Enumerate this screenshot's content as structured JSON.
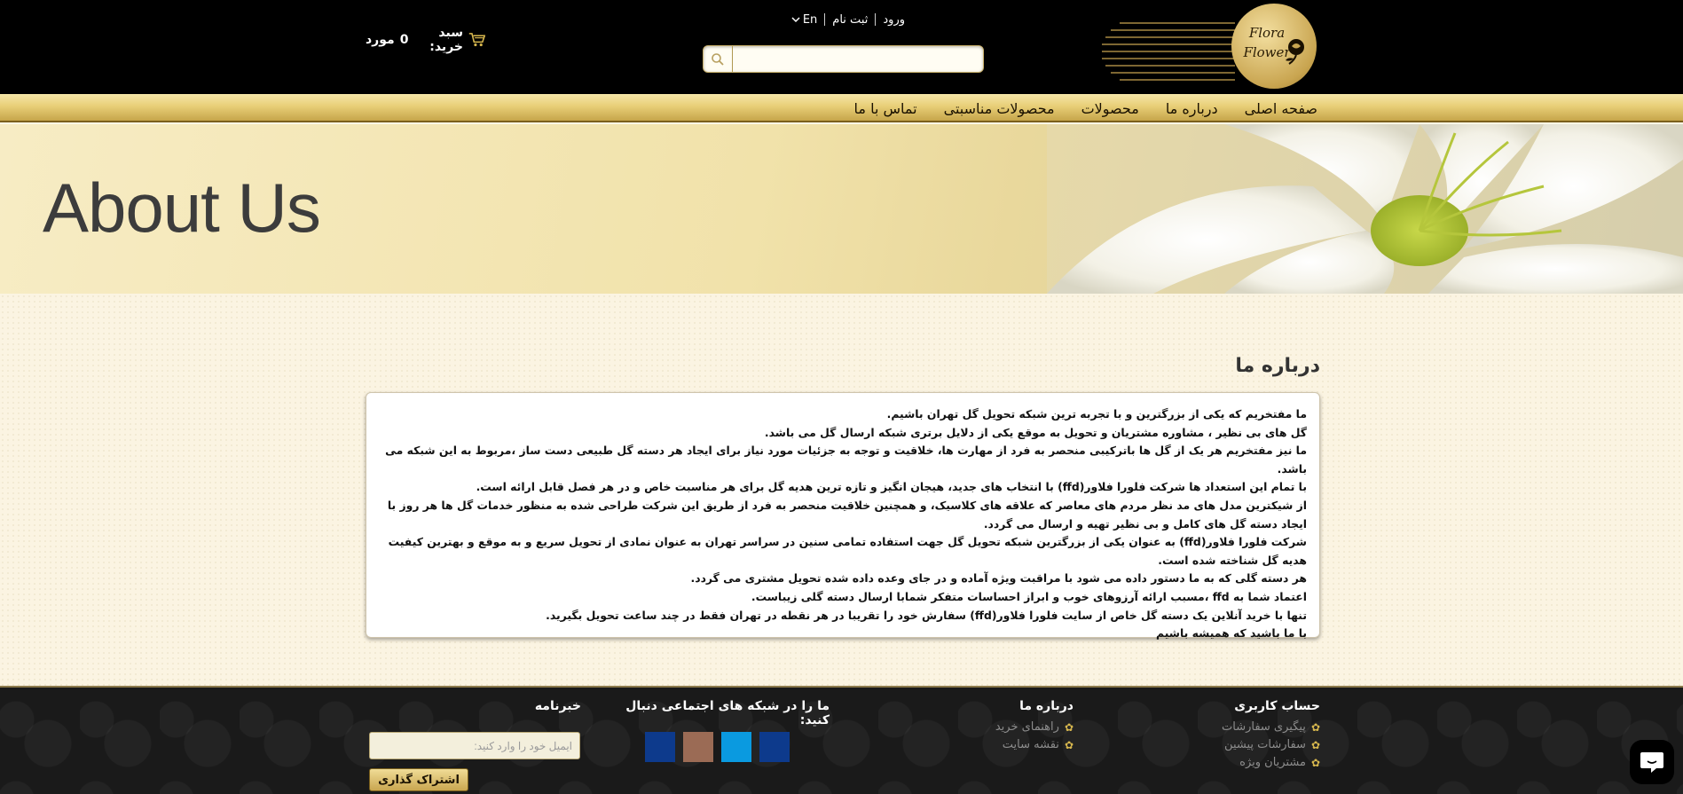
{
  "header": {
    "logo": {
      "line1": "Flora",
      "line2": "Flower"
    },
    "top_links": {
      "login": "ورود",
      "register": "ثبت نام",
      "language": "En"
    },
    "search": {
      "placeholder": ""
    },
    "cart": {
      "label": "سبد خرید:",
      "count": "0",
      "unit": "مورد"
    }
  },
  "nav": {
    "items": [
      {
        "label": "صفحه اصلی"
      },
      {
        "label": "درباره ما"
      },
      {
        "label": "محصولات"
      },
      {
        "label": "محصولات مناسبتی"
      },
      {
        "label": "تماس با ما"
      }
    ]
  },
  "banner": {
    "title": "About Us"
  },
  "main": {
    "title": "درباره ما",
    "paragraphs": [
      "ما مفتخریم که یکی از بزرگترین و با تجربه ترین شبکه تحویل گل تهران باشیم.",
      "گل های بی نظیر ، مشاوره مشتریان و تحویل به موقع یکی از دلایل برتری شبکه ارسال گل می باشد.",
      "ما نیز مفتخریم هر یک از گل ها باترکیبی منحصر به فرد از مهارت ها، خلاقیت و توجه به جزئیات مورد نیاز برای ایجاد هر دسته گل طبیعی دست ساز ،مربوط به این شبکه می باشد.",
      "با تمام این استعداد ها  شرکت فلورا فلاور(ffd) با انتخاب های جدید، هیجان انگیز و تازه ترین هدیه گل برای هر مناسبت خاص و در هر فصل قابل ارائه است.",
      "از شیکترین مدل های مد نظر مردم های معاصر که علاقه های کلاسیک، و همچنین خلاقیت منحصر به فرد از طریق این شرکت طراحی شده به منظور خدمات گل ها هر روز با ایجاد دسته گل های کامل و بی نظیر تهیه و ارسال می گردد.",
      "شرکت فلورا فلاور(ffd) به عنوان یکی از بزرگترین شبکه تحویل گل جهت استفاده تمامی سنین در سراسر تهران به عنوان نمادی از تحویل سریع و به موقع و بهترین کیفیت هدیه گل شناخته شده است.",
      "هر دسته گلی که به ما دستور داده می شود با مراقبت ویژه آماده و در جای وعده داده شده تحویل مشتری می گردد.",
      "اعتماد شما به ffd ،مسبب ارائه آرزوهای خوب و ابراز احساسات متفکر شمابا ارسال دسته گلی زیباست.",
      "تنها با خرید آنلاین یک دسته گل خاص از سایت فلورا فلاور(ffd) سفارش خود را تقریبا در هر نقطه در تهران فقط در چند ساعت تحویل بگیرید.",
      "با ما باشید که همیشه باشیم"
    ]
  },
  "footer": {
    "account": {
      "title": "حساب کاربری",
      "items": [
        {
          "label": "پیگیری سفارشات"
        },
        {
          "label": "سفارشات پیشین"
        },
        {
          "label": "مشتریان ویژه"
        }
      ]
    },
    "about": {
      "title": "درباره ما",
      "items": [
        {
          "label": "راهنمای خرید"
        },
        {
          "label": "نقشه سایت"
        }
      ]
    },
    "social": {
      "title": "ما را در شبکه های اجتماعی دنبال کنید:",
      "icons": [
        {
          "name": "facebook-icon",
          "color": "#0d3a8c"
        },
        {
          "name": "instagram-icon",
          "color": "#9b6b55"
        },
        {
          "name": "twitter-icon",
          "color": "#0a9ae0"
        },
        {
          "name": "linkedin-icon",
          "color": "#0d3a8c"
        }
      ]
    },
    "newsletter": {
      "title": "خبرنامه",
      "placeholder": "ایمیل خود را وارد کنید:",
      "button": "اشتراک گذاری"
    }
  },
  "colors": {
    "gold": "#d8b84e",
    "header_bg": "#000000",
    "content_bg": "#fbf4e2"
  }
}
